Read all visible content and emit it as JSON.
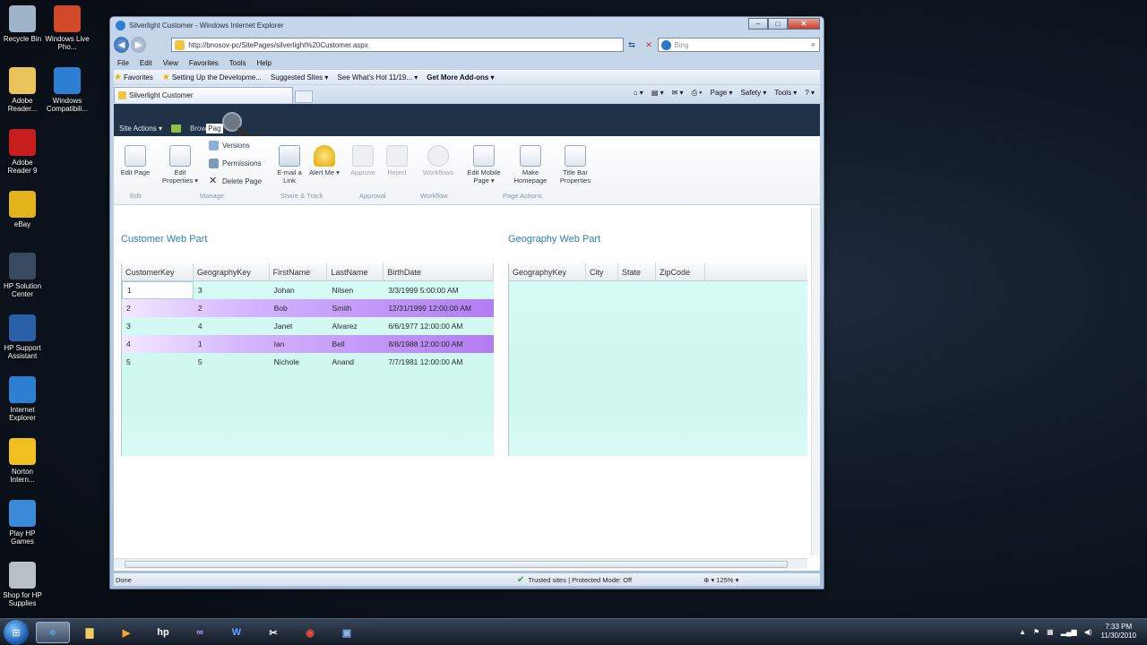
{
  "desktop": {
    "col1": [
      {
        "label": "Recycle Bin",
        "icon": "recycle-bin-icon",
        "color": "#9fb3c8"
      },
      {
        "label": "Adobe Reader...",
        "icon": "folder-icon",
        "color": "#e8c45a"
      },
      {
        "label": "Adobe Reader 9",
        "icon": "adobe-reader-icon",
        "color": "#c81e1e"
      },
      {
        "label": "eBay",
        "icon": "ebay-icon",
        "color": "#e2b31a"
      },
      {
        "label": "HP Solution Center",
        "icon": "hp-solution-icon",
        "color": "#3a4a5e"
      },
      {
        "label": "HP Support Assistant",
        "icon": "hp-support-icon",
        "color": "#2a60a8"
      },
      {
        "label": "Internet Explorer",
        "icon": "internet-explorer-icon",
        "color": "#2d7fd1"
      },
      {
        "label": "Norton Intern...",
        "icon": "norton-icon",
        "color": "#f0c020"
      },
      {
        "label": "Play HP Games",
        "icon": "hp-games-icon",
        "color": "#3a8ad8"
      },
      {
        "label": "Shop for HP Supplies",
        "icon": "hp-shop-icon",
        "color": "#b8c0c8"
      }
    ],
    "col2": [
      {
        "label": "Windows Live Pho...",
        "icon": "windows-live-photo-icon",
        "color": "#d04a2a"
      },
      {
        "label": "Windows Compatibili...",
        "icon": "ie-compat-icon",
        "color": "#2d7fd1"
      }
    ]
  },
  "browser": {
    "title": "Silverlight Customer - Windows Internet Explorer",
    "caption_min": "‒",
    "caption_max": "□",
    "caption_close": "✕",
    "address": "http://bnosov-pc/SitePages/silverlight%20Customer.aspx",
    "search_placeholder": "Bing",
    "menu": [
      "File",
      "Edit",
      "View",
      "Favorites",
      "Tools",
      "Help"
    ],
    "favorites": [
      "Favorites",
      "Setting Up the Developme...",
      "Suggested Sites ▾",
      "See What's Hot 11/19... ▾",
      "Get More Add-ons ▾"
    ],
    "tab_title": "Silverlight Customer",
    "commands": [
      "Page ▾",
      "Safety ▾",
      "Tools ▾",
      "? ▾"
    ],
    "status_left": "Done",
    "status_zone": "Trusted sites | Protected Mode: Off",
    "zoom": "125%"
  },
  "sharepoint": {
    "site_actions": "Site Actions ▾",
    "browse_tab": "Brow",
    "page_tab": "Pag",
    "ribbon": {
      "edit_page": "Edit Page",
      "edit_properties": "Edit Properties ▾",
      "versions": "Versions",
      "permissions": "Permissions",
      "delete_page": "Delete Page",
      "email_link": "E-mail a Link",
      "alert_me": "Alert Me ▾",
      "approve": "Approve",
      "reject": "Reject",
      "workflows": "Workflows",
      "edit_mobile": "Edit Mobile Page ▾",
      "make_homepage": "Make Homepage",
      "title_bar": "Title Bar Properties",
      "groups": [
        "Edit",
        "Manage",
        "Share & Track",
        "Approval",
        "Workflow",
        "Page Actions"
      ]
    },
    "customer_title": "Customer Web Part",
    "geography_title": "Geography Web Part",
    "customer_columns": [
      "CustomerKey",
      "GeographyKey",
      "FirstName",
      "LastName",
      "BirthDate"
    ],
    "customer_rows": [
      [
        "1",
        "3",
        "Johan",
        "Nilsen",
        "3/3/1999 5:00:00 AM"
      ],
      [
        "2",
        "2",
        "Bob",
        "Smith",
        "12/31/1999 12:00:00 AM"
      ],
      [
        "3",
        "4",
        "Janet",
        "Alvarez",
        "6/6/1977 12:00:00 AM"
      ],
      [
        "4",
        "1",
        "Ian",
        "Bell",
        "8/8/1988 12:00:00 AM"
      ],
      [
        "5",
        "5",
        "Nichole",
        "Anand",
        "7/7/1981 12:00:00 AM"
      ]
    ],
    "geography_columns": [
      "GeographyKey",
      "City",
      "State",
      "ZipCode"
    ]
  },
  "taskbar": {
    "time": "7:33 PM",
    "date": "11/30/2010"
  }
}
